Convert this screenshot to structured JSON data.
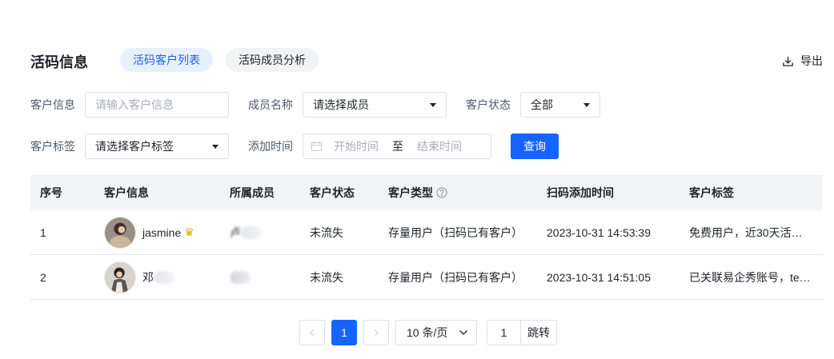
{
  "header": {
    "title": "活码信息",
    "tabs": [
      {
        "label": "活码客户列表",
        "active": true
      },
      {
        "label": "活码成员分析",
        "active": false
      }
    ],
    "export_label": "导出"
  },
  "filters": {
    "customer_info_label": "客户信息",
    "customer_info_placeholder": "请输入客户信息",
    "member_label": "成员名称",
    "member_value": "请选择成员",
    "status_label": "客户状态",
    "status_value": "全部",
    "tag_label": "客户标签",
    "tag_value": "请选择客户标签",
    "time_label": "添加时间",
    "time_start_placeholder": "开始时间",
    "time_separator": "至",
    "time_end_placeholder": "结束时间",
    "query_label": "查询"
  },
  "table": {
    "columns": [
      "序号",
      "客户信息",
      "所属成员",
      "客户状态",
      "客户类型",
      "扫码添加时间",
      "客户标签"
    ],
    "rows": [
      {
        "index": "1",
        "customer": "jasmine",
        "member": "卢",
        "status": "未流失",
        "type": "存量用户（扫码已有客户）",
        "time": "2023-10-31 14:53:39",
        "tags": "免费用户，近30天活…"
      },
      {
        "index": "2",
        "customer": "邓",
        "member": "",
        "status": "未流失",
        "type": "存量用户（扫码已有客户）",
        "time": "2023-10-31 14:51:05",
        "tags": "已关联易企秀账号，te…"
      }
    ]
  },
  "pagination": {
    "current_page": "1",
    "page_size": "10 条/页",
    "jump_value": "1",
    "jump_label": "跳转"
  },
  "colors": {
    "primary": "#1664ff",
    "tab_active_bg": "#e8f0fe"
  }
}
